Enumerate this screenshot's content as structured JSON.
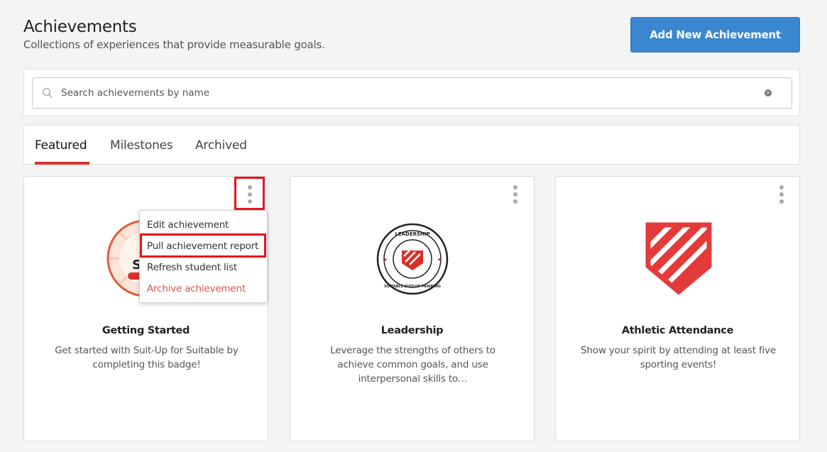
{
  "header": {
    "title": "Achievements",
    "subtitle": "Collections of experiences that provide measurable goals.",
    "add_button": "Add New Achievement"
  },
  "search": {
    "placeholder": "Search achievements by name",
    "value": ""
  },
  "tabs": [
    {
      "label": "Featured",
      "active": true
    },
    {
      "label": "Milestones",
      "active": false
    },
    {
      "label": "Archived",
      "active": false
    }
  ],
  "cards": [
    {
      "title": "Getting Started",
      "description": "Get started with Suit-Up for Suitable by completing this badge!",
      "badge_text": "GETTING STARTED"
    },
    {
      "title": "Leadership",
      "description": "Leverage the strengths of others to achieve common goals, and use interpersonal skills to…",
      "badge_top_text": "LEADERSHIP",
      "badge_bottom_text": "SUITABLE SUIT-UP TRAINING"
    },
    {
      "title": "Athletic Attendance",
      "description": "Show your spirit by attending at least five sporting events!"
    }
  ],
  "context_menu": {
    "items": [
      {
        "label": "Edit achievement",
        "danger": false
      },
      {
        "label": "Pull achievement report",
        "danger": false
      },
      {
        "label": "Refresh student list",
        "danger": false
      },
      {
        "label": "Archive achievement",
        "danger": true
      }
    ]
  },
  "colors": {
    "brand_red": "#d9302a",
    "primary_blue": "#3a87cf",
    "highlight_red": "#e3141d"
  }
}
